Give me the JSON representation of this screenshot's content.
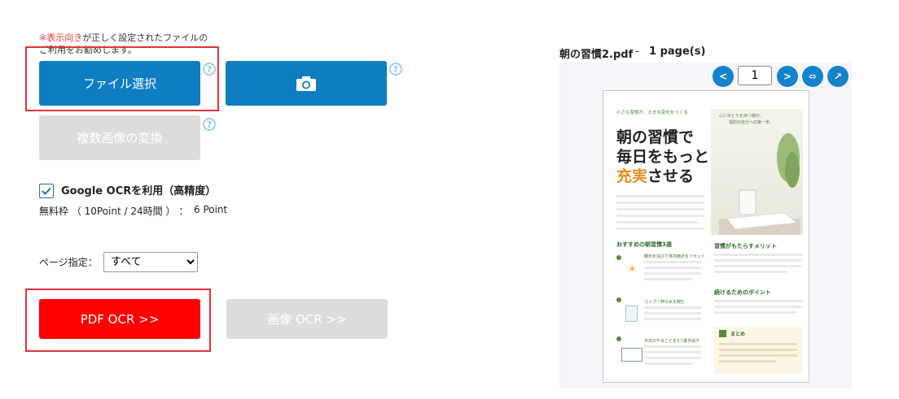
{
  "note": {
    "highlight": "※表示向き",
    "rest": "が正しく設定されたファイルの",
    "line2": "ご利用をお勧めします。"
  },
  "buttons": {
    "file_select": "ファイル選択",
    "multi_convert": "複数画像の変換",
    "pdf_ocr": "PDF OCR >>",
    "image_ocr": "画像 OCR >>"
  },
  "help_glyph": "?",
  "google_ocr": {
    "label": "Google OCRを利用（高精度）",
    "checked": true
  },
  "free_quota": {
    "label": "無料枠 （ 10Point / 24時間 ） ：",
    "value": "6 Point"
  },
  "page_select": {
    "label": "ページ指定：",
    "selected": "すべて",
    "options": [
      "すべて"
    ]
  },
  "viewer": {
    "filename": "朝の習慣2.pdf",
    "separator": "-",
    "pages": "1 page(s)",
    "prev": "<",
    "next": ">",
    "current_page": "1",
    "fit_glyph": "⬄",
    "open_glyph": "↗"
  },
  "document": {
    "tagline": "小さな習慣が、大きな変化をつくる",
    "title1": "朝の習慣で",
    "title2": "毎日をもっと",
    "title3a": "充実",
    "title3b": "させる",
    "photo_caption1": "心にゆとりを持つ朝が、",
    "photo_caption2": "理想の自分への第一歩。",
    "sec_recommend": "おすすめの朝習慣3選",
    "sec_merit": "習慣がもたらすメリット",
    "sec_continue": "続けるためのポイント",
    "item1": "朝日を浴びて体内時計をリセット",
    "item2": "コップ一杯の水を飲む",
    "item3": "今日のやることを3つ書き出す",
    "summary": "まとめ"
  },
  "colors": {
    "blue": "#0f7dc2",
    "red": "#ff0000",
    "gray": "#dcdcdc",
    "highlight": "#e0343a"
  }
}
